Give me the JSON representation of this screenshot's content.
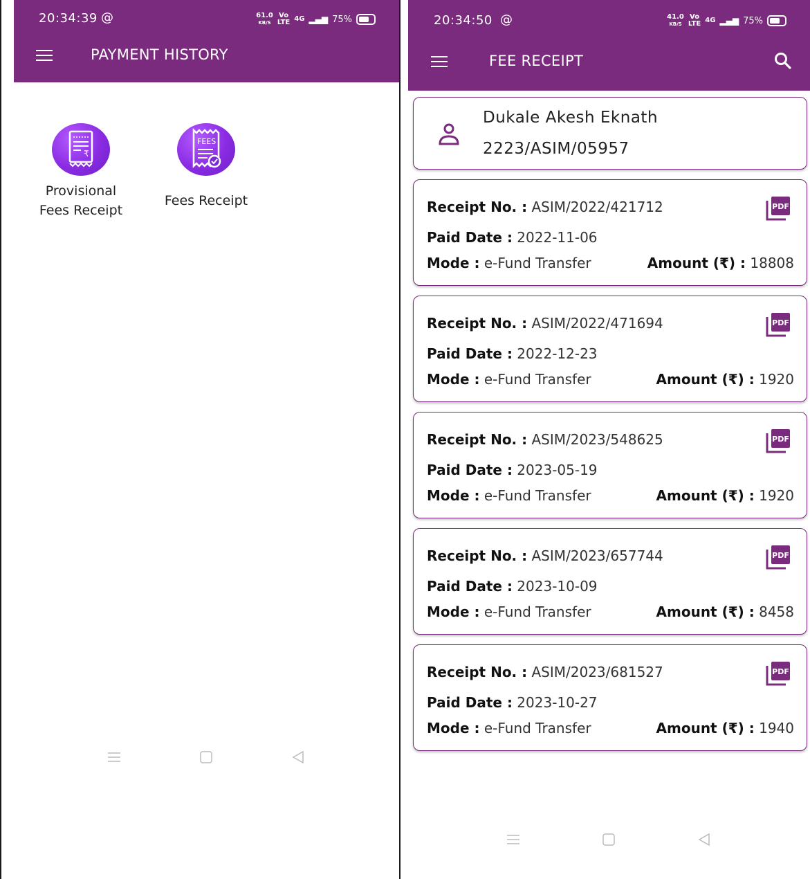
{
  "left_screen": {
    "status": {
      "time": "20:34:39",
      "speed": "61.0",
      "speed_unit": "KB/S",
      "network": "4G",
      "battery": "75%"
    },
    "header": {
      "title": "PAYMENT HISTORY"
    },
    "tiles": [
      {
        "label_line1": "Provisional",
        "label_line2": "Fees Receipt",
        "icon": "receipt-rupee-icon"
      },
      {
        "label_line1": "Fees Receipt",
        "icon": "fees-receipt-icon",
        "icon_text": "FEES"
      }
    ]
  },
  "right_screen": {
    "status": {
      "time": "20:34:50",
      "speed": "41.0",
      "speed_unit": "KB/S",
      "network": "4G",
      "battery": "75%"
    },
    "header": {
      "title": "FEE RECEIPT"
    },
    "student": {
      "name": "Dukale Akesh Eknath",
      "id": "2223/ASIM/05957"
    },
    "labels": {
      "receipt_no": "Receipt No. :",
      "paid_date": "Paid Date :",
      "mode": "Mode :",
      "amount": "Amount (₹) :",
      "pdf": "PDF"
    },
    "receipts": [
      {
        "receipt_no": "ASIM/2022/421712",
        "paid_date": "2022-11-06",
        "mode": "e-Fund Transfer",
        "amount": "18808"
      },
      {
        "receipt_no": "ASIM/2022/471694",
        "paid_date": "2022-12-23",
        "mode": "e-Fund Transfer",
        "amount": "1920"
      },
      {
        "receipt_no": "ASIM/2023/548625",
        "paid_date": "2023-05-19",
        "mode": "e-Fund Transfer",
        "amount": "1920"
      },
      {
        "receipt_no": "ASIM/2023/657744",
        "paid_date": "2023-10-09",
        "mode": "e-Fund Transfer",
        "amount": "8458"
      },
      {
        "receipt_no": "ASIM/2023/681527",
        "paid_date": "2023-10-27",
        "mode": "e-Fund Transfer",
        "amount": "1940"
      }
    ]
  },
  "colors": {
    "app_bar": "#7b2b7e",
    "icon_gradient": "#8a2be2",
    "card_border": "#7b2b7e"
  }
}
